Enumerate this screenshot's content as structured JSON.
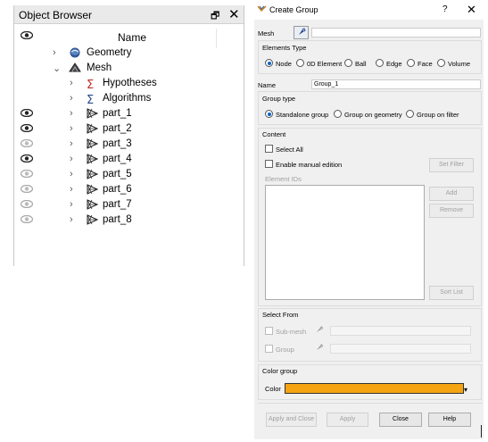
{
  "object_browser": {
    "title": "Object Browser",
    "column_name": "Name",
    "tree": [
      {
        "label": "Geometry",
        "level": 1,
        "expanded": false,
        "icon": "geometry-icon",
        "visible": null
      },
      {
        "label": "Mesh",
        "level": 1,
        "expanded": true,
        "icon": "mesh-icon",
        "visible": null
      },
      {
        "label": "Hypotheses",
        "level": 2,
        "expanded": false,
        "icon": "hypotheses-icon",
        "visible": null
      },
      {
        "label": "Algorithms",
        "level": 2,
        "expanded": false,
        "icon": "algorithms-icon",
        "visible": null
      },
      {
        "label": "part_1",
        "level": 2,
        "expanded": false,
        "icon": "submesh-icon",
        "visible": true
      },
      {
        "label": "part_2",
        "level": 2,
        "expanded": false,
        "icon": "submesh-icon",
        "visible": true
      },
      {
        "label": "part_3",
        "level": 2,
        "expanded": false,
        "icon": "submesh-icon",
        "visible": false
      },
      {
        "label": "part_4",
        "level": 2,
        "expanded": false,
        "icon": "submesh-icon",
        "visible": true
      },
      {
        "label": "part_5",
        "level": 2,
        "expanded": false,
        "icon": "submesh-icon",
        "visible": false
      },
      {
        "label": "part_6",
        "level": 2,
        "expanded": false,
        "icon": "submesh-icon",
        "visible": false
      },
      {
        "label": "part_7",
        "level": 2,
        "expanded": false,
        "icon": "submesh-icon",
        "visible": false
      },
      {
        "label": "part_8",
        "level": 2,
        "expanded": false,
        "icon": "submesh-icon",
        "visible": false
      }
    ]
  },
  "dialog": {
    "title": "Create Group",
    "help_glyph": "?",
    "close_glyph": "✕",
    "mesh_label": "Mesh",
    "mesh_value": "",
    "elements_type": {
      "title": "Elements Type",
      "options": [
        "Node",
        "0D Element",
        "Ball",
        "Edge",
        "Face",
        "Volume"
      ],
      "selected": "Node"
    },
    "name_label": "Name",
    "name_value": "Group_1",
    "group_type": {
      "title": "Group type",
      "options": [
        "Standalone group",
        "Group on geometry",
        "Group on filter"
      ],
      "selected": "Standalone group"
    },
    "content": {
      "title": "Content",
      "select_all": "Select All",
      "enable_manual": "Enable manual edition",
      "set_filter": "Set Filter",
      "element_ids": "Element IDs",
      "add": "Add",
      "remove": "Remove",
      "sort_list": "Sort List"
    },
    "select_from": {
      "title": "Select From",
      "submesh": "Sub-mesh",
      "group": "Group"
    },
    "color_group": {
      "title": "Color group",
      "color_label": "Color",
      "color_value": "#f5a511"
    },
    "buttons": {
      "apply_close": "Apply and Close",
      "apply": "Apply",
      "close": "Close",
      "help": "Help"
    }
  },
  "colors": {
    "accent": "#0a66c2",
    "icon_blue": "#2a4a8a",
    "icon_red": "#c0302a"
  }
}
